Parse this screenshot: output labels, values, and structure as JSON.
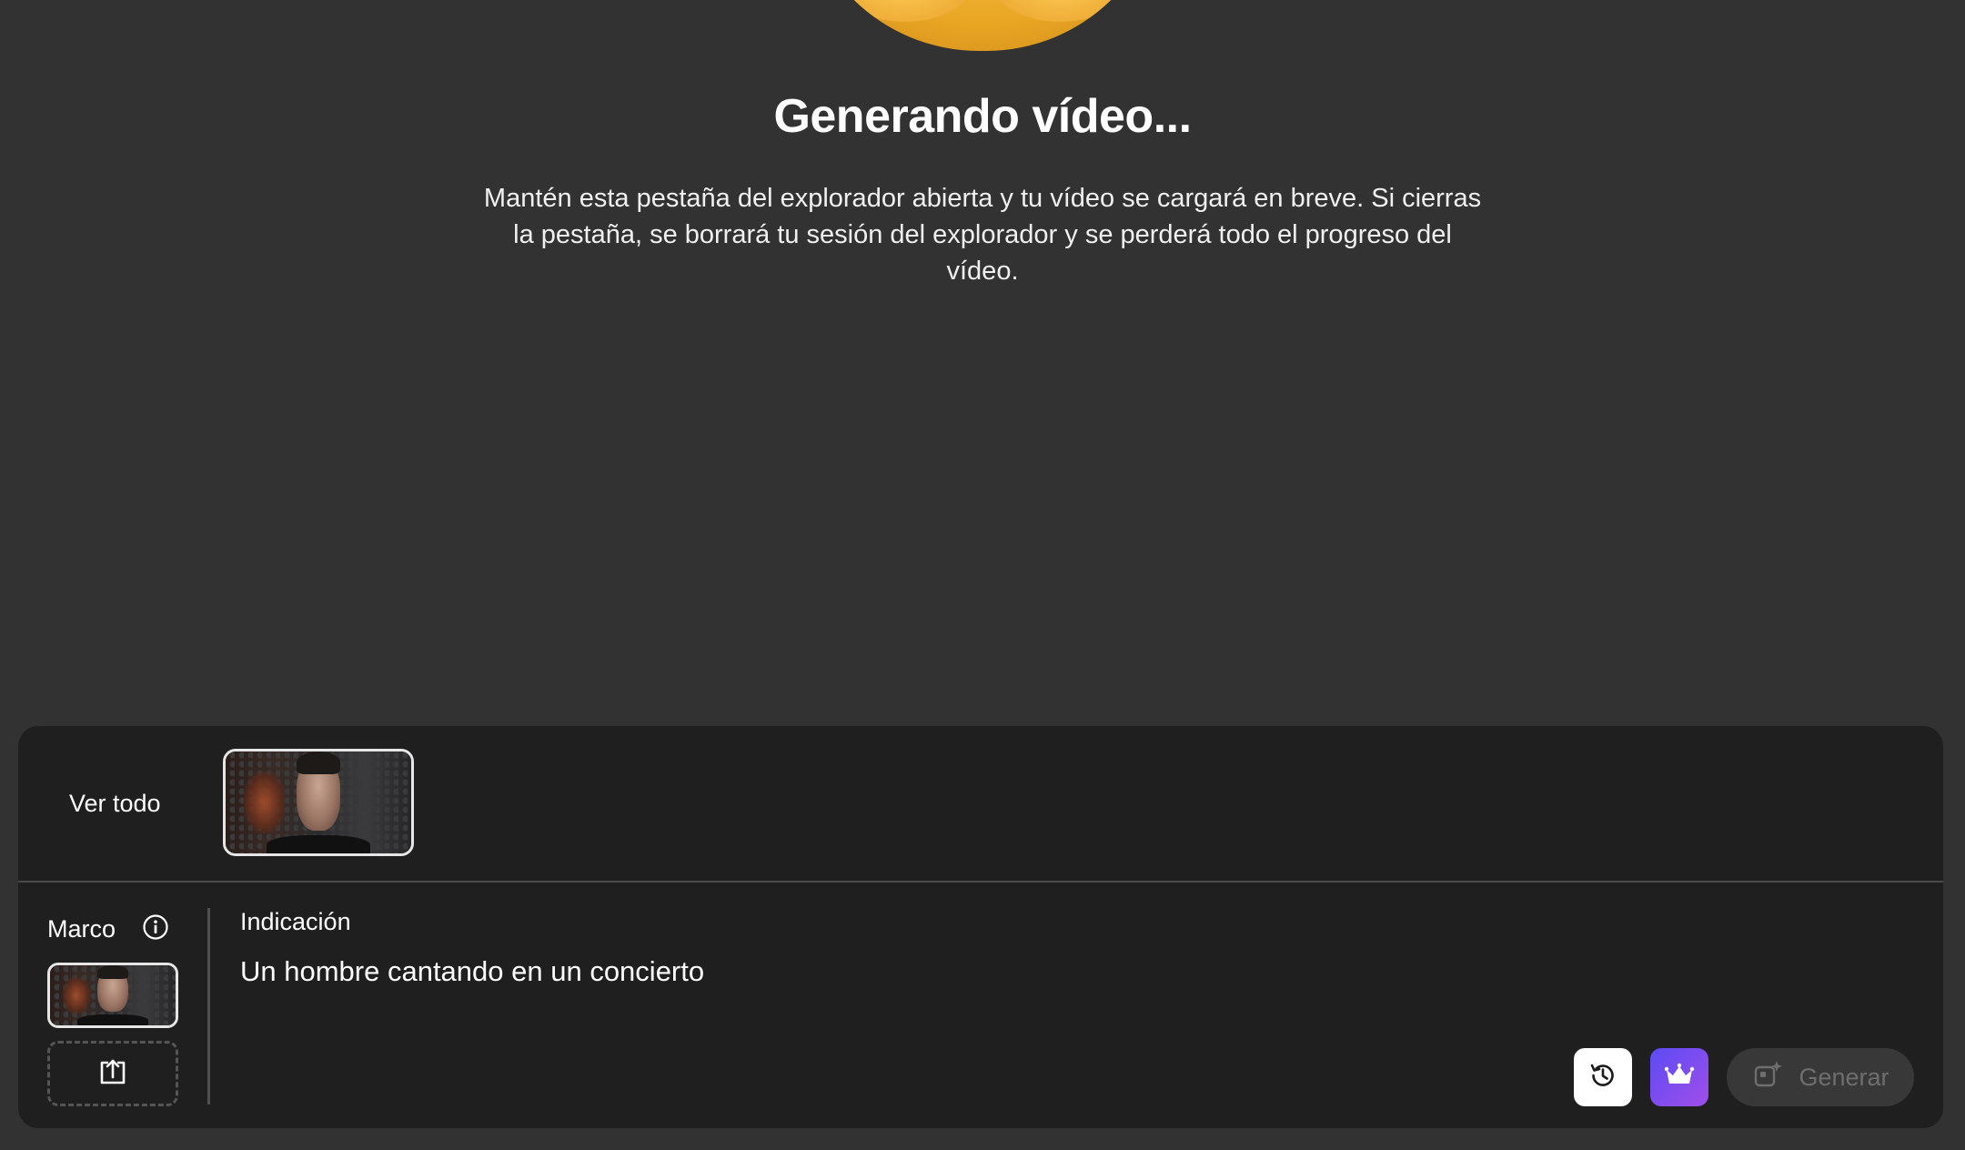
{
  "header": {
    "title": "Generando vídeo...",
    "description": "Mantén esta pestaña del explorador abierta y tu vídeo se cargará en breve. Si cierras la pestaña, se borrará tu sesión del explorador y se perderá todo el progreso del vídeo."
  },
  "history": {
    "see_all_label": "Ver todo"
  },
  "frame": {
    "label": "Marco"
  },
  "prompt": {
    "label": "Indicación",
    "value": "Un hombre cantando en un concierto"
  },
  "actions": {
    "generate_label": "Generar"
  },
  "icons": {
    "info": "info-icon",
    "upload": "upload-icon",
    "history": "history-icon",
    "premium": "crown-icon",
    "generate": "generate-sparkle-icon"
  },
  "colors": {
    "background": "#323232",
    "panel": "#1f1f1f",
    "premium_gradient_start": "#5b4bf5",
    "premium_gradient_end": "#a14ee8",
    "generate_disabled_bg": "#383838",
    "generate_disabled_text": "#6e6e6e"
  }
}
